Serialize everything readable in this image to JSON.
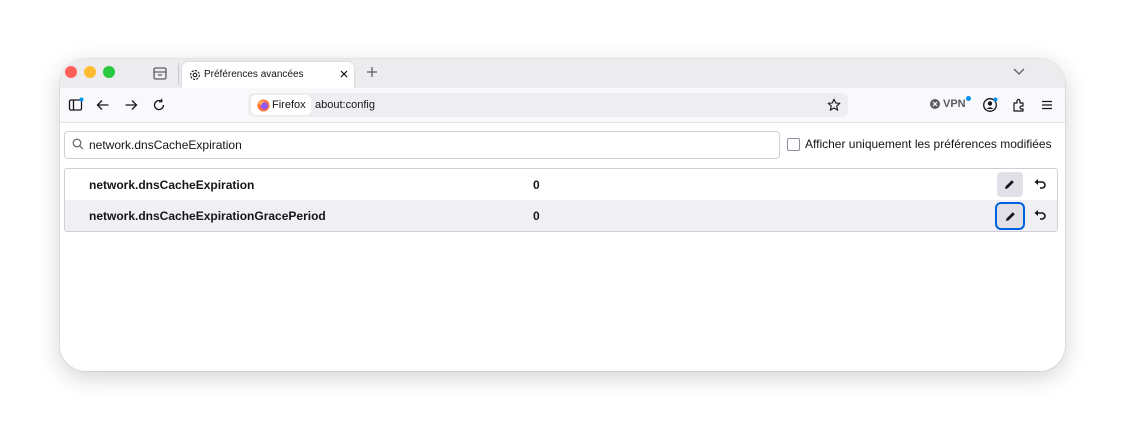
{
  "tab": {
    "title": "Préférences avancées"
  },
  "urlbar": {
    "identity_label": "Firefox",
    "url": "about:config"
  },
  "toolbar": {
    "vpn_label": "VPN"
  },
  "search": {
    "value": "network.dnsCacheExpiration"
  },
  "filter": {
    "label": "Afficher uniquement les préférences modifiées",
    "checked": false
  },
  "preferences": [
    {
      "name": "network.dnsCacheExpiration",
      "value": "0"
    },
    {
      "name": "network.dnsCacheExpirationGracePeriod",
      "value": "0"
    }
  ],
  "colors": {
    "focus": "#0061e0",
    "row_alt": "#f0f0f4",
    "accent_dot": "#0090ed"
  },
  "icons": [
    "tabs-list-icon",
    "gear-icon",
    "close-icon",
    "plus-icon",
    "chevron-down-icon",
    "sidebar-icon",
    "back-icon",
    "forward-icon",
    "reload-icon",
    "firefox-logo-icon",
    "star-icon",
    "account-icon",
    "extensions-icon",
    "menu-icon",
    "search-icon",
    "pencil-icon",
    "undo-icon"
  ]
}
